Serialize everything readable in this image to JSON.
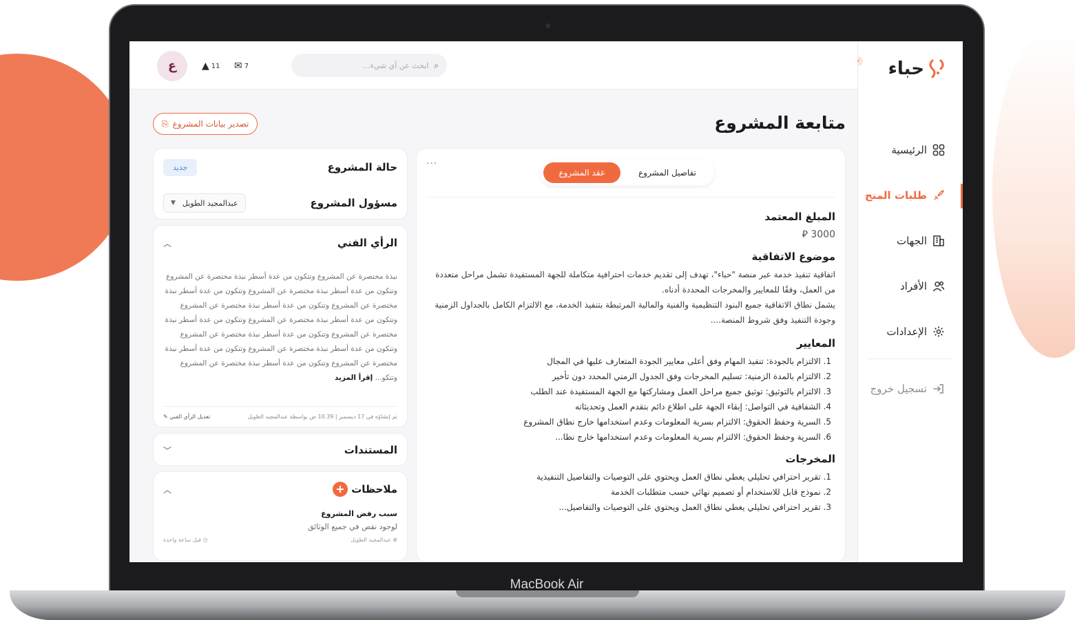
{
  "device": {
    "label": "MacBook Air"
  },
  "brand": {
    "name": "حباء",
    "accent": "#f06a40"
  },
  "sidebar": {
    "items": [
      {
        "label": "الرئيسية",
        "icon": "grid-icon"
      },
      {
        "label": "طلبات المنح",
        "icon": "rocket-icon",
        "active": true
      },
      {
        "label": "الجهات",
        "icon": "building-icon"
      },
      {
        "label": "الأفراد",
        "icon": "users-icon"
      },
      {
        "label": "الإعدادات",
        "icon": "gear-icon"
      }
    ],
    "logout_label": "تسجيل خروج"
  },
  "topbar": {
    "search_placeholder": "ابحث عن أي شيء...",
    "notifications_count": "11",
    "messages_count": "7",
    "avatar_initial": "ع"
  },
  "page": {
    "title": "متابعة المشروع",
    "export_label": "تصدير بيانات المشروع"
  },
  "tabs": [
    {
      "label": "تفاصيل المشروع",
      "active": false
    },
    {
      "label": "عقد المشروع",
      "active": true
    }
  ],
  "contract": {
    "amount_heading": "المبلغ المعتمد",
    "amount_value": "3000 ⃁",
    "subject_heading": "موضوع الاتفاقية",
    "subject_p1": "اتفاقية تنفيذ خدمة عبر منصة \"حباء\"، تهدف إلى تقديم خدمات احترافية متكاملة للجهة المستفيدة تشمل مراحل متعددة من العمل، وفقًا للمعايير والمخرجات المحددة أدناه.",
    "subject_p2": "يشمل نطاق الاتفاقية جميع البنود التنظيمية والفنية والمالية المرتبطة بتنفيذ الخدمة، مع الالتزام الكامل بالجداول الزمنية وجودة التنفيذ وفق شروط المنصة....",
    "criteria_heading": "المعايير",
    "criteria": [
      "1. الالتزام بالجودة: تنفيذ المهام وفق أعلى معايير الجودة المتعارف عليها في المجال",
      "2. الالتزام بالمدة الزمنية: تسليم المخرجات وفق الجدول الزمني المحدد دون تأخير",
      "3. الالتزام بالتوثيق: توثيق جميع مراحل العمل ومشاركتها مع الجهة المستفيدة عند الطلب",
      "4. الشفافية في التواصل: إبقاء الجهة على اطلاع دائم بتقدم العمل وتحديثاته",
      "5. السرية وحفظ الحقوق: الالتزام بسرية المعلومات وعدم استخدامها خارج نطاق المشروع",
      "6. السرية وحفظ الحقوق: الالتزام بسرية المعلومات وعدم استخدامها خارج نطا..."
    ],
    "outputs_heading": "المخرجات",
    "outputs": [
      "1. تقرير احترافي تحليلي يغطي نطاق العمل ويحتوي على التوصيات والتفاصيل التنفيذية",
      "2. نموذج قابل للاستخدام أو تصميم نهائي حسب متطلبات الخدمة",
      "3. تقرير احترافي تحليلي يغطي نطاق العمل ويحتوي على التوصيات والتفاصيل..."
    ]
  },
  "status_panel": {
    "status_label": "حالة المشروع",
    "status_value": "جديد",
    "owner_label": "مسؤول المشروع",
    "owner_value": "عبدالمجيد الطويل"
  },
  "opinion": {
    "heading": "الرأي الفني",
    "text": "نبذة مختصرة عن المشروع وتتكون من عدة أسطر نبذة مختصرة عن المشروع وتتكون من عدة أسطر  نبذة مختصرة عن المشروع وتتكون من عدة أسطر نبذة مختصرة عن المشروع وتتكون من عدة أسطر نبذة مختصرة عن المشروع وتتكون من عدة أسطر نبذة مختصرة عن المشروع وتتكون من عدة أسطر نبذة مختصرة عن المشروع وتتكون من عدة أسطر  نبذة مختصرة عن المشروع وتتكون من عدة أسطر نبذة مختصرة عن المشروع وتتكون من عدة أسطر نبذة مختصرة عن المشروع وتتكون من عدة أسطر نبذة مختصرة عن المشروع وتتكو...",
    "read_more": "إقرأ المزيد",
    "meta": "تم إنشاؤه في 17 ديسمبر | 10.39 ص بواسطة عبدالمجيد الطويل",
    "edit_label": "تعديل الرأي الفني"
  },
  "documents": {
    "heading": "المستندات"
  },
  "notes": {
    "heading": "ملاحظات",
    "items": [
      {
        "title": "سبب رفض المشروع",
        "body": "لوجود نقص في جميع الوثائق",
        "author": "عبدالمجيد الطويل",
        "time": "قبل ساعة واحدة"
      }
    ]
  }
}
